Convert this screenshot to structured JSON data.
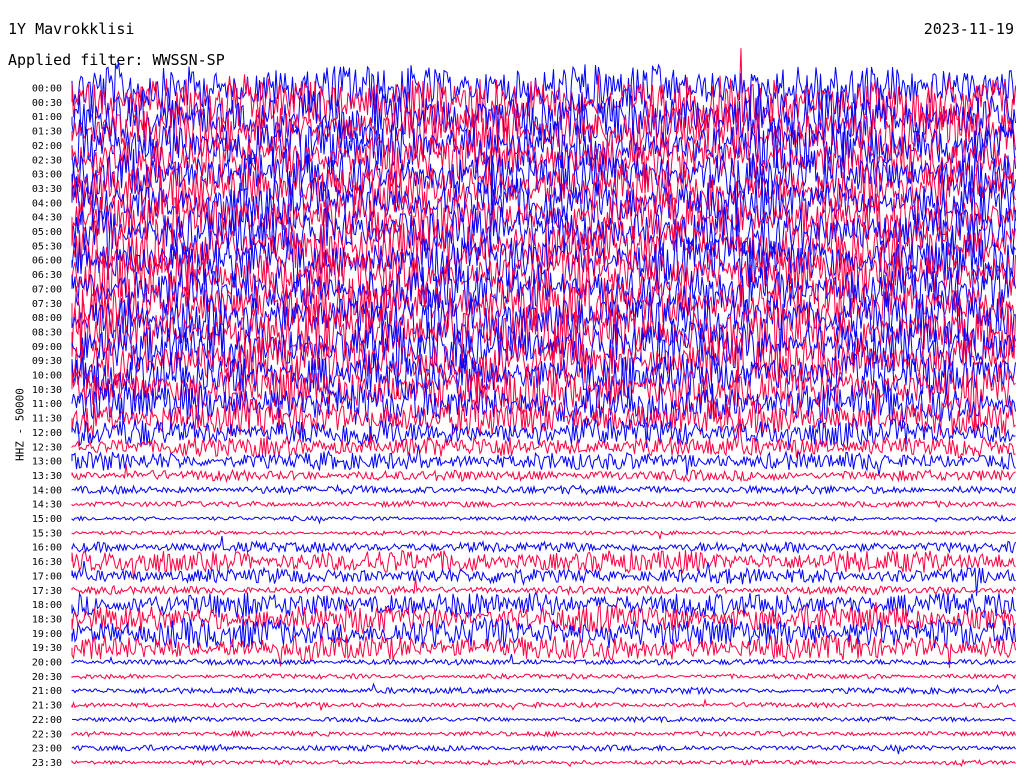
{
  "header": {
    "station": "1Y Mavrokklisi",
    "date": "2023-11-19",
    "filter": "Applied filter: WWSSN-SP"
  },
  "colors": {
    "even": "#0000ff",
    "odd": "#ff0040"
  },
  "chart_data": {
    "type": "line",
    "ylabel": "HHZ - 50000",
    "rows": [
      {
        "label": "00:00",
        "level": 0.9
      },
      {
        "label": "00:30",
        "level": 1.0
      },
      {
        "label": "01:00",
        "level": 1.0
      },
      {
        "label": "01:30",
        "level": 1.0
      },
      {
        "label": "02:00",
        "level": 0.95
      },
      {
        "label": "02:30",
        "level": 0.9
      },
      {
        "label": "03:00",
        "level": 0.9
      },
      {
        "label": "03:30",
        "level": 0.95
      },
      {
        "label": "04:00",
        "level": 0.9
      },
      {
        "label": "04:30",
        "level": 0.9
      },
      {
        "label": "05:00",
        "level": 0.95
      },
      {
        "label": "05:30",
        "level": 1.0
      },
      {
        "label": "06:00",
        "level": 0.95
      },
      {
        "label": "06:30",
        "level": 0.95
      },
      {
        "label": "07:00",
        "level": 0.9
      },
      {
        "label": "07:30",
        "level": 0.95
      },
      {
        "label": "08:00",
        "level": 1.0
      },
      {
        "label": "08:30",
        "level": 1.0
      },
      {
        "label": "09:00",
        "level": 0.95
      },
      {
        "label": "09:30",
        "level": 0.9
      },
      {
        "label": "10:00",
        "level": 0.85
      },
      {
        "label": "10:30",
        "level": 0.85
      },
      {
        "label": "11:00",
        "level": 0.8
      },
      {
        "label": "11:30",
        "level": 0.65
      },
      {
        "label": "12:00",
        "level": 0.5
      },
      {
        "label": "12:30",
        "level": 0.35
      },
      {
        "label": "13:00",
        "level": 0.3
      },
      {
        "label": "13:30",
        "level": 0.15
      },
      {
        "label": "14:00",
        "level": 0.1
      },
      {
        "label": "14:30",
        "level": 0.05
      },
      {
        "label": "15:00",
        "level": 0.02
      },
      {
        "label": "15:30",
        "level": 0.01
      },
      {
        "label": "16:00",
        "level": 0.15
      },
      {
        "label": "16:30",
        "level": 0.4
      },
      {
        "label": "17:00",
        "level": 0.25
      },
      {
        "label": "17:30",
        "level": 0.1
      },
      {
        "label": "18:00",
        "level": 0.45
      },
      {
        "label": "18:30",
        "level": 0.5
      },
      {
        "label": "19:00",
        "level": 0.55
      },
      {
        "label": "19:30",
        "level": 0.45
      },
      {
        "label": "20:00",
        "level": 0.05
      },
      {
        "label": "20:30",
        "level": 0.03
      },
      {
        "label": "21:00",
        "level": 0.05
      },
      {
        "label": "21:30",
        "level": 0.03
      },
      {
        "label": "22:00",
        "level": 0.03
      },
      {
        "label": "22:30",
        "level": 0.03
      },
      {
        "label": "23:00",
        "level": 0.05
      },
      {
        "label": "23:30",
        "level": 0.02
      }
    ]
  }
}
